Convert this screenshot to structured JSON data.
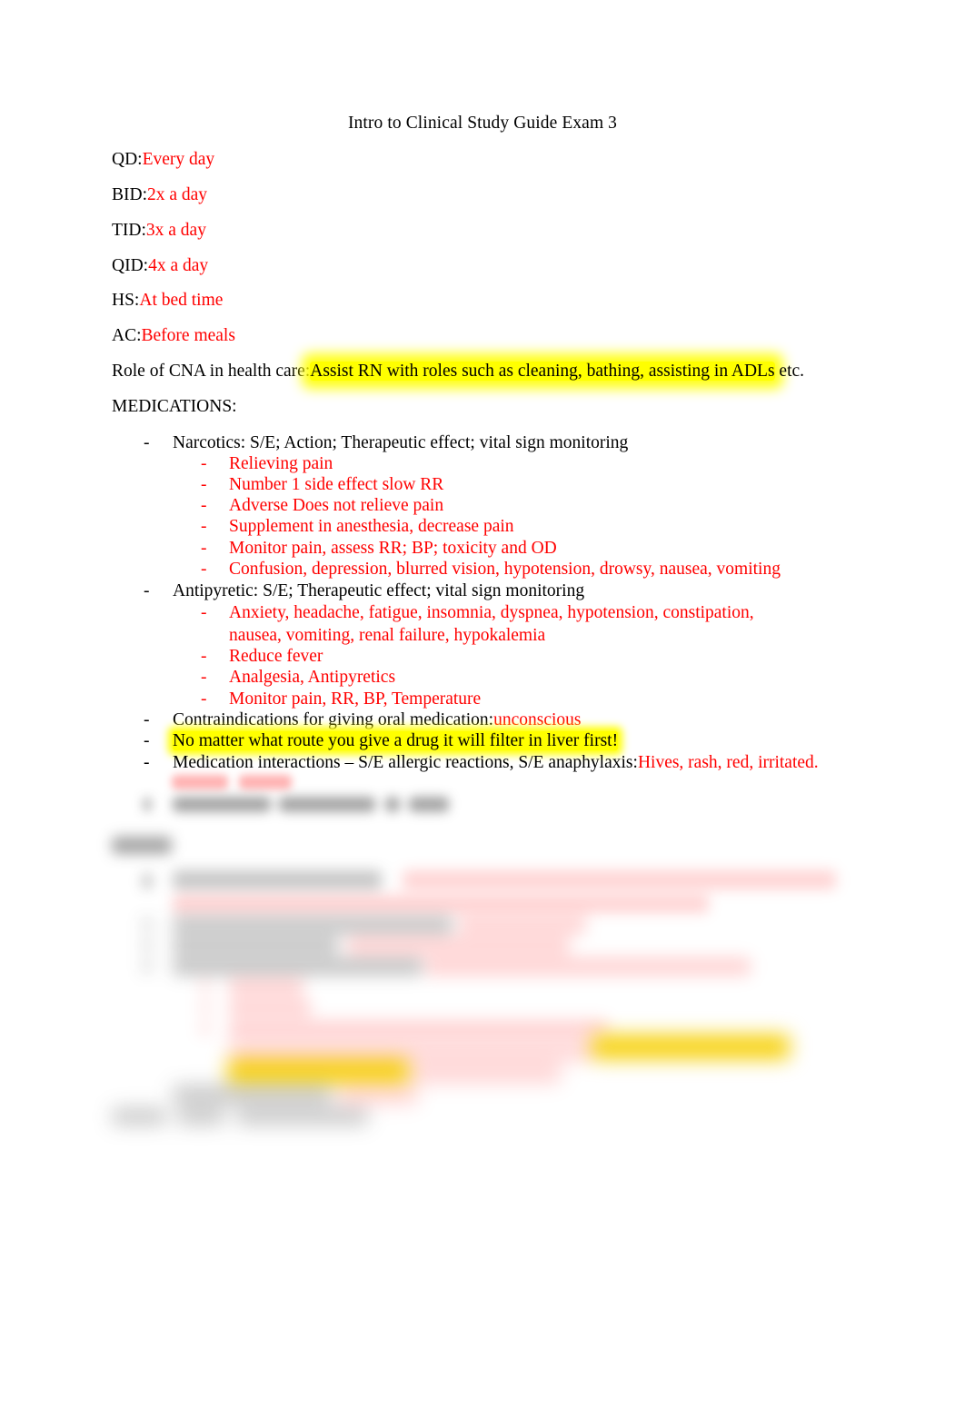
{
  "document": {
    "title": "Intro to Clinical Study Guide Exam 3",
    "colors": {
      "text": "#000000",
      "accent_red": "#FF0000",
      "highlight_yellow": "#FFFF00",
      "page_background": "#FFFFFF"
    }
  },
  "abbreviations": [
    {
      "term": "QD:",
      "definition": "Every day"
    },
    {
      "term": "BID:",
      "definition": "2x a day"
    },
    {
      "term": "TID:",
      "definition": "3x a day"
    },
    {
      "term": "QID:",
      "definition": "4x a day"
    },
    {
      "term": "HS:",
      "definition": "At bed time"
    },
    {
      "term": "AC:",
      "definition": "Before meals"
    }
  ],
  "cna_role": {
    "label": "Role of CNA in health care:",
    "highlighted": "Assist RN with roles such as cleaning, bathing, assisting in ADLs",
    "trailing": " etc."
  },
  "medications_heading": "MEDICATIONS:",
  "medications": [
    {
      "label": "Narcotics: S/E; Action; Therapeutic effect; vital sign monitoring",
      "sub": [
        "Relieving pain",
        "Number 1 side effect slow RR",
        "Adverse Does not relieve pain",
        "Supplement in anesthesia, decrease pain",
        "Monitor pain, assess RR; BP; toxicity and OD",
        "Confusion, depression, blurred vision, hypotension, drowsy, nausea, vomiting"
      ]
    },
    {
      "label": "Antipyretic: S/E; Therapeutic effect; vital sign monitoring",
      "sub": [
        "Anxiety, headache, fatigue, insomnia, dyspnea, hypotension, constipation, nausea, vomiting, renal failure, hypokalemia",
        "Reduce fever",
        "Analgesia, Antipyretics",
        "Monitor pain, RR, BP, Temperature"
      ]
    }
  ],
  "notes": [
    {
      "label": "Contraindications for giving oral medication:",
      "answer": "unconscious",
      "highlight": false
    },
    {
      "label": "No matter what route you give a drug it will filter in liver first!",
      "answer": "",
      "highlight": true
    },
    {
      "label": "Medication interactions – S/E allergic reactions, S/E anaphylaxis:",
      "answer": "Hives, rash, red, irritated.",
      "highlight": false
    }
  ],
  "obscured_region": {
    "note": "Lower portion of page is blurred and illegible"
  }
}
